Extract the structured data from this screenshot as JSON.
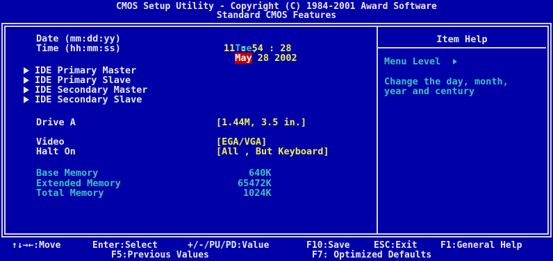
{
  "header": {
    "line1": "CMOS Setup Utility - Copyright (C) 1984-2001 Award Software",
    "line2": "Standard CMOS Features"
  },
  "fields": {
    "date_label": "Date (mm:dd:yy)",
    "date_day": "Tue,",
    "date_month": "May",
    "date_rest": " 28 2002",
    "time_label": "Time (hh:mm:ss)",
    "time_value": "11 : 54 : 28",
    "ide_items": [
      "IDE Primary Master",
      "IDE Primary Slave",
      "IDE Secondary Master",
      "IDE Secondary Slave"
    ],
    "drive_a_label": "Drive A",
    "drive_a_value": "[1.44M, 3.5 in.]",
    "video_label": "Video",
    "video_value": "[EGA/VGA]",
    "halt_label": "Halt On",
    "halt_value": "[All , But Keyboard]",
    "base_mem_label": "Base Memory",
    "base_mem_value": "640K",
    "ext_mem_label": "Extended Memory",
    "ext_mem_value": "65472K",
    "total_mem_label": "Total Memory",
    "total_mem_value": "1024K"
  },
  "help": {
    "title": "Item Help",
    "menu_level": "Menu Level",
    "text_line1": "Change the day, month,",
    "text_line2": "year and century"
  },
  "footer": {
    "move": "↑↓→←:Move",
    "select": "Enter:Select",
    "value": "+/-/PU/PD:Value",
    "save": "F10:Save",
    "exit": "ESC:Exit",
    "help": "F1:General Help",
    "prev": "F5:Previous Values",
    "optimized": "F7: Optimized Defaults"
  },
  "colors": {
    "background": "#0000a8",
    "label": "#e8e8e8",
    "value": "#f0f048",
    "info": "#40c0c0",
    "highlight": "#c40000"
  }
}
